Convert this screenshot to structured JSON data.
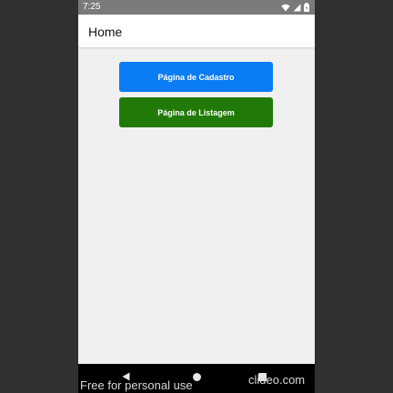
{
  "status_bar": {
    "time": "7:25",
    "icons": [
      "wifi-icon",
      "signal-icon",
      "battery-icon"
    ]
  },
  "header": {
    "title": "Home"
  },
  "main": {
    "buttons": [
      {
        "label": "Página de Cadastro",
        "color": "#0a7cf4"
      },
      {
        "label": "Página de Listagem",
        "color": "#217a07"
      }
    ]
  },
  "nav_bar": {
    "icons": [
      "back-icon",
      "home-icon",
      "recent-apps-icon"
    ]
  },
  "watermark": {
    "left_text": "Free for personal use",
    "right_text": "clideo.com"
  }
}
